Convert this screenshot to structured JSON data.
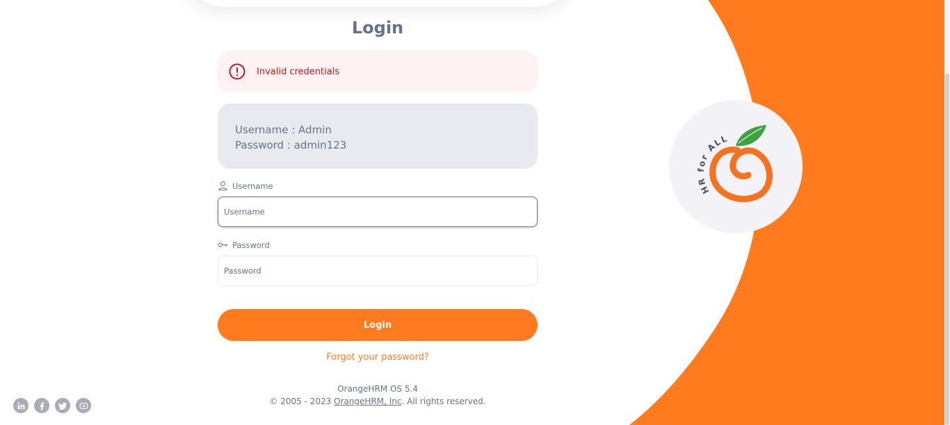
{
  "page": {
    "title": "Login"
  },
  "alert": {
    "text": "Invalid credentials",
    "icon": "alert-circle-icon"
  },
  "credentials_hint": {
    "username_line": "Username : Admin",
    "password_line": "Password : admin123"
  },
  "form": {
    "username": {
      "label": "Username",
      "placeholder": "Username",
      "value": "",
      "icon": "user-icon"
    },
    "password": {
      "label": "Password",
      "placeholder": "Password",
      "value": "",
      "icon": "key-icon"
    },
    "submit_label": "Login",
    "forgot_link": "Forgot your password?"
  },
  "footer": {
    "version": "OrangeHRM OS 5.4",
    "copyright_prefix": "© 2005 - 2023 ",
    "company_link": "OrangeHRM, Inc",
    "copyright_suffix": ". All rights reserved."
  },
  "socials": [
    {
      "name": "linkedin",
      "icon": "linkedin-icon"
    },
    {
      "name": "facebook",
      "icon": "facebook-icon"
    },
    {
      "name": "twitter",
      "icon": "twitter-icon"
    },
    {
      "name": "youtube",
      "icon": "youtube-icon"
    }
  ],
  "branding": {
    "logo_text": "HR for ALL",
    "colors": {
      "accent": "#ff7b1d",
      "text": "#64728c",
      "error": "#c4141e",
      "alert_bg": "#fff2f2",
      "hint_bg": "#e8eaef",
      "leaf": "#3ea23e"
    }
  }
}
